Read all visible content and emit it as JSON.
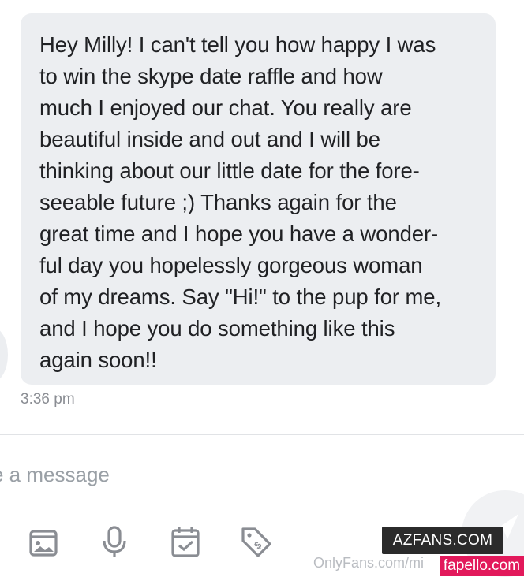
{
  "message": {
    "text": "Hey Milly! I can't tell you how happy I was\nto win the skype date raffle and how\nmuch I enjoyed our chat. You really are\nbeautiful inside and out and I will be\nthinking about our little date for the fore-\nseeable future ;) Thanks again for the\ngreat time and I hope you have a wonder-\nful day you hopelessly gorgeous woman\nof my dreams. Say \"Hi!\" to the pup for me,\nand I hope you do something like this\nagain soon!!",
    "time": "3:36 pm"
  },
  "composer": {
    "placeholder": "e a message"
  },
  "toolbar": {
    "icons": [
      "media-icon",
      "microphone-icon",
      "calendar-check-icon",
      "price-tag-icon"
    ]
  },
  "watermarks": {
    "azfans": "AZFANS.COM",
    "onlyfans": "OnlyFans.com/mi",
    "fapello": "fapello.com"
  },
  "colors": {
    "bubble": "#eceef1",
    "icon": "#8a8d93",
    "fapello_badge": "#e2195b"
  }
}
